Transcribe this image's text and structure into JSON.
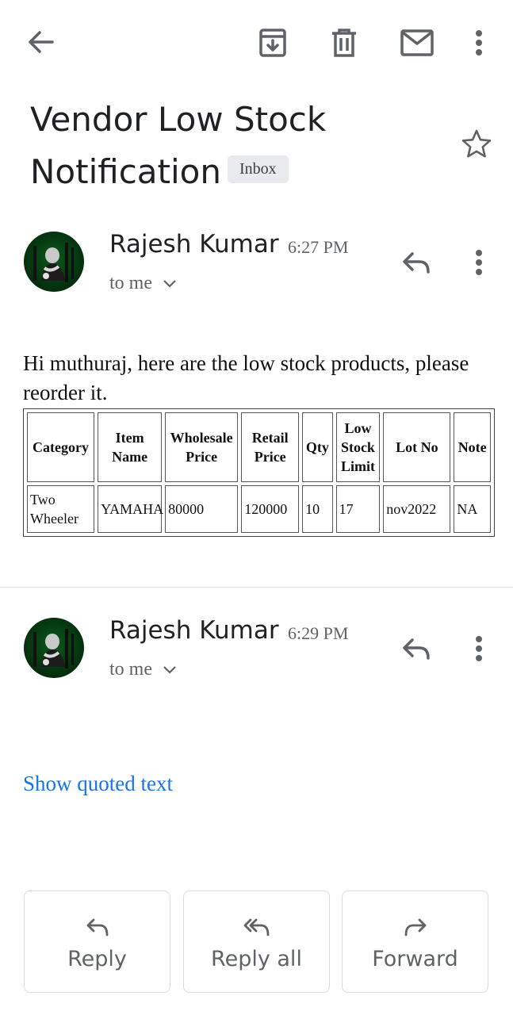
{
  "toolbar": {
    "back_icon": "arrow-back-icon",
    "archive_icon": "archive-icon",
    "delete_icon": "trash-icon",
    "mark_unread_icon": "mail-icon",
    "more_icon": "more-vert-icon"
  },
  "email": {
    "subject": "Vendor Low Stock Notification",
    "label": "Inbox",
    "star_icon": "star-outline-icon"
  },
  "messages": [
    {
      "sender": "Rajesh Kumar",
      "time": "6:27 PM",
      "recipient": "to me",
      "body": "Hi muthuraj, here are the low stock products, please reorder it.",
      "table": {
        "headers": [
          "Category",
          "Item Name",
          "Wholesale Price",
          "Retail Price",
          "Qty",
          "Low Stock Limit",
          "Lot No",
          "Note"
        ],
        "rows": [
          [
            "Two Wheeler",
            "YAMAHA",
            "80000",
            "120000",
            "10",
            "17",
            "nov2022",
            "NA"
          ]
        ]
      }
    },
    {
      "sender": "Rajesh Kumar",
      "time": "6:29 PM",
      "recipient": "to me",
      "show_quoted": "Show quoted text"
    }
  ],
  "actions": {
    "reply": "Reply",
    "reply_all": "Reply all",
    "forward": "Forward"
  },
  "colors": {
    "link": "#1a73e8",
    "icon": "#5f6368",
    "badge_bg": "#e8eaed"
  }
}
